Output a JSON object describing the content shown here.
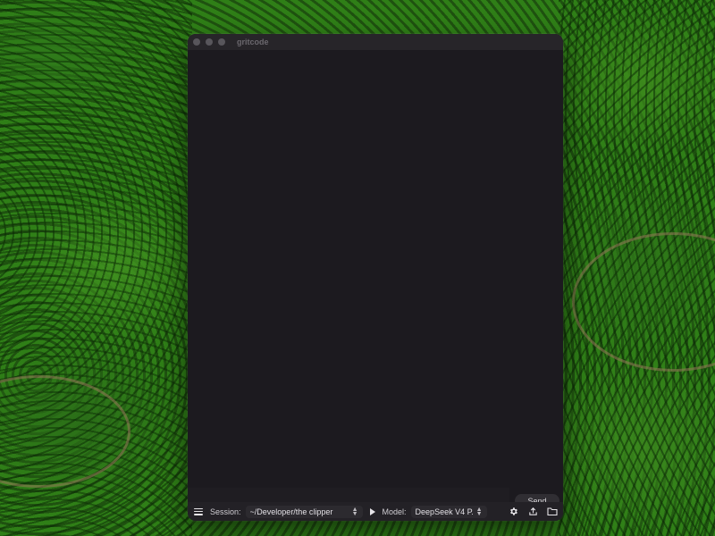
{
  "window": {
    "title": "gritcode"
  },
  "composer": {
    "send_label": "Send"
  },
  "toolbar": {
    "session_label": "Session:",
    "session_value": "~/Developer/the clipper",
    "model_label": "Model:",
    "model_value": "DeepSeek V4 P..."
  },
  "colors": {
    "window_bg": "#1c1a1f",
    "toolbar_bg": "#232126",
    "send_bg": "#302e33"
  },
  "icons": {
    "menu": "hamburger-menu-icon",
    "run": "play-icon",
    "settings": "gear-icon",
    "share": "upload-icon",
    "folder": "folder-icon"
  }
}
